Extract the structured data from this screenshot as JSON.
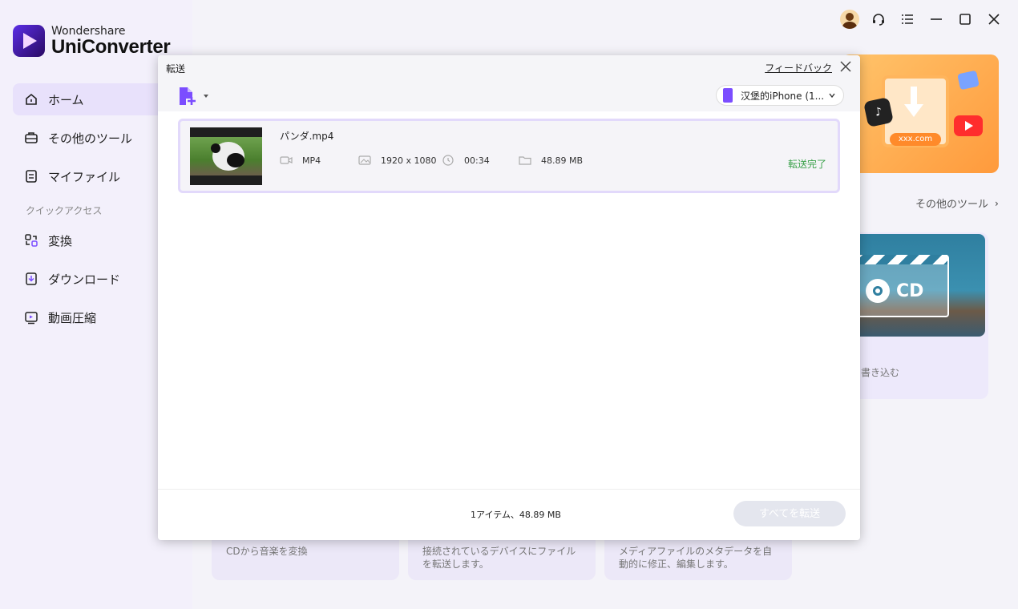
{
  "app": {
    "brand_company": "Wondershare",
    "brand_name": "UniConverter"
  },
  "sidebar": {
    "items": [
      {
        "label": "ホーム",
        "icon": "home-icon",
        "active": true
      },
      {
        "label": "その他のツール",
        "icon": "toolbox-icon",
        "active": false
      },
      {
        "label": "マイファイル",
        "icon": "file-icon",
        "active": false
      }
    ],
    "quick_access_label": "クイックアクセス",
    "quick_items": [
      {
        "label": "変換",
        "icon": "convert-icon"
      },
      {
        "label": "ダウンロード",
        "icon": "download-icon"
      },
      {
        "label": "動画圧縮",
        "icon": "compress-icon"
      }
    ]
  },
  "home": {
    "more_tools_label": "その他のツール",
    "banner_url": "xxx.com",
    "cd_card": {
      "label": "CD",
      "caption": "書き込む"
    },
    "bottom_cards": [
      "CDから音楽を変換",
      "接続されているデバイスにファイルを転送します。",
      "メディアファイルのメタデータを自動的に修正、編集します。"
    ]
  },
  "dialog": {
    "title": "転送",
    "feedback": "フィードバック",
    "device": "汉堡的iPhone (1...",
    "files": [
      {
        "name": "パンダ.mp4",
        "format": "MP4",
        "resolution": "1920 x 1080",
        "duration": "00:34",
        "size": "48.89 MB",
        "status": "転送完了"
      }
    ],
    "summary": "1アイテム、48.89 MB",
    "transfer_all": "すべてを転送"
  },
  "colors": {
    "accent": "#7b4dff",
    "success": "#3aa14a",
    "sidebar_bg": "#f3f0fb",
    "active_item": "#e8e1fb"
  }
}
